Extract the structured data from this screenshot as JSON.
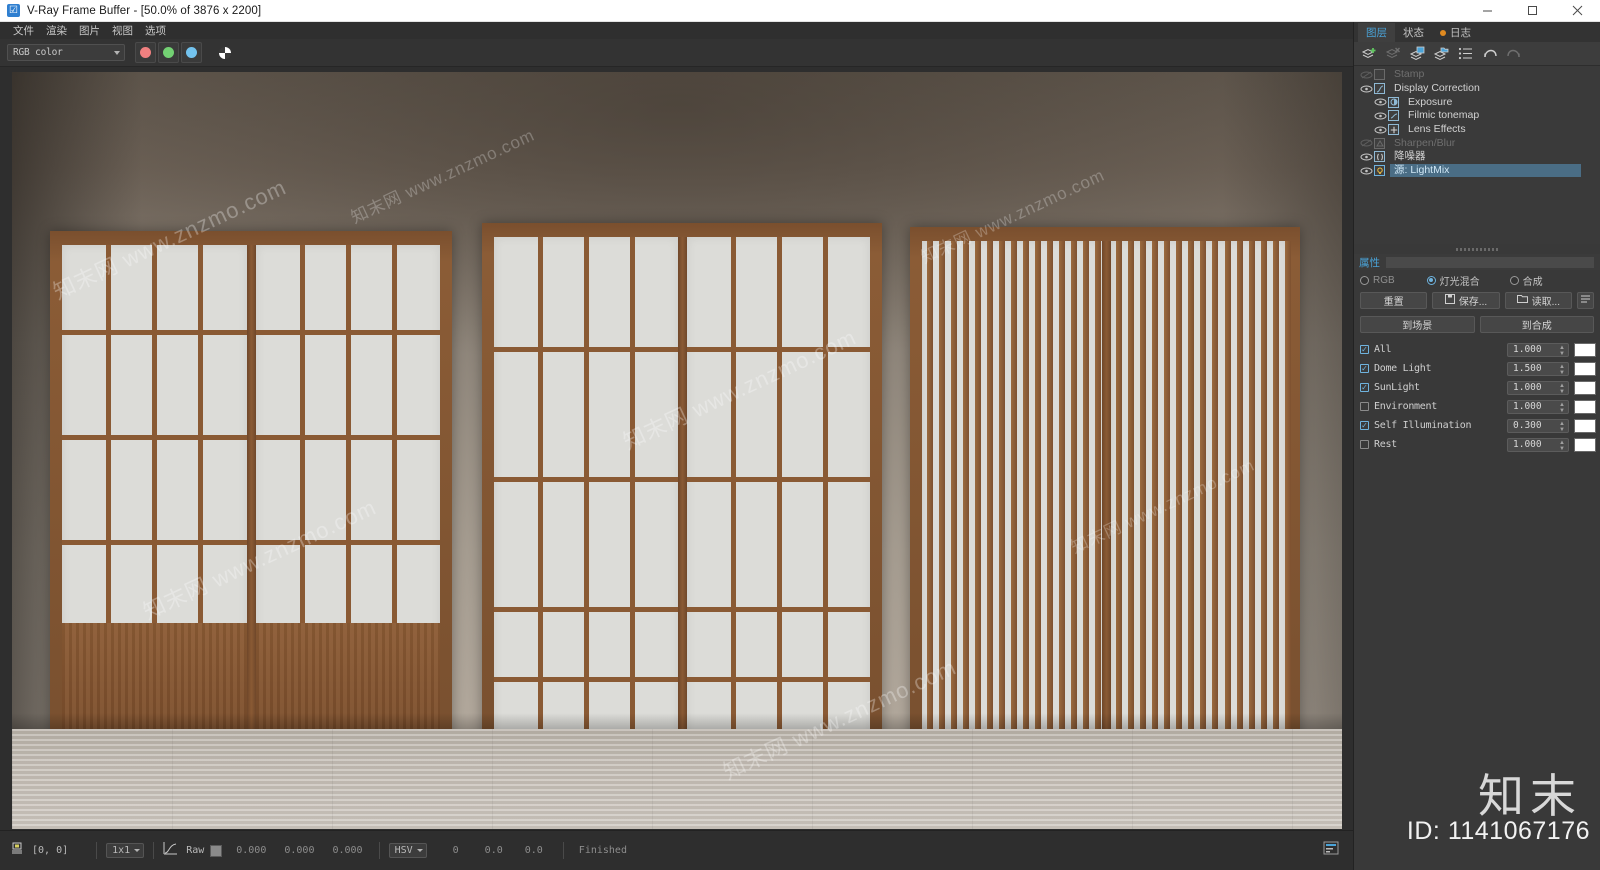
{
  "window": {
    "title": "V-Ray Frame Buffer - [50.0% of 3876 x 2200]",
    "app_icon": "vray-icon",
    "minimize": "−",
    "maximize": "□",
    "close": "✕"
  },
  "menu": {
    "items": [
      {
        "label": "文件",
        "name": "menu-file"
      },
      {
        "label": "渲染",
        "name": "menu-render"
      },
      {
        "label": "图片",
        "name": "menu-image"
      },
      {
        "label": "视图",
        "name": "menu-view"
      },
      {
        "label": "选项",
        "name": "menu-options"
      }
    ]
  },
  "toolbar": {
    "channel_select": {
      "value": "RGB color",
      "placeholder": "RGB color"
    },
    "channels": [
      {
        "name": "red-channel-button",
        "color": "#f08080"
      },
      {
        "name": "green-channel-button",
        "color": "#73d173"
      },
      {
        "name": "blue-channel-button",
        "color": "#73c3ee"
      }
    ],
    "alpha_button": "alpha-channel-button",
    "right_icons": [
      {
        "name": "save-image-icon"
      },
      {
        "name": "save-all-image-channels-icon"
      },
      {
        "name": "region-render-icon"
      },
      {
        "name": "show-vfb-window-icon"
      },
      {
        "name": "start-render-icon"
      },
      {
        "name": "stop-render-icon"
      },
      {
        "name": "render-last-icon"
      }
    ]
  },
  "render_view": {
    "description": "Japanese-style interior render: three wooden sliding shoji door units on a taupe wall, light gray wood plank floor",
    "watermarks": [
      "知末网 www.znzmo.com",
      "知末网 www.znzmo.com",
      "知末网 www.znzmo.com",
      "知末网 www.znzmo.com",
      "知末网 www.znzmo.com",
      "知末网 www.znzmo.com",
      "知末网 www.znzmo.com"
    ],
    "brand_watermark": {
      "logo": "知末",
      "id": "ID: 1141067176"
    }
  },
  "statusbar": {
    "pixel_icon": "pixel-probe-icon",
    "coords": "[0,  0]",
    "sample_size": "1x1",
    "curve_icon": "color-curve-icon",
    "raw_label": "Raw",
    "raw_swatch": "#8a8a8a",
    "raw_values": [
      "0.000",
      "0.000",
      "0.000"
    ],
    "color_space": "HSV",
    "hsv_values": [
      "0",
      "0.0",
      "0.0"
    ],
    "status": "Finished",
    "right_icon": "show-log-icon"
  },
  "right_panel": {
    "tabs": [
      {
        "label": "图层",
        "name": "tab-layers",
        "active": true,
        "dot": false
      },
      {
        "label": "状态",
        "name": "tab-status",
        "active": false,
        "dot": false
      },
      {
        "label": "日志",
        "name": "tab-log",
        "active": false,
        "dot": true
      }
    ],
    "layer_toolbar": [
      {
        "name": "add-layer-icon"
      },
      {
        "name": "delete-layer-icon"
      },
      {
        "name": "save-layer-preset-icon"
      },
      {
        "name": "load-layer-preset-icon"
      },
      {
        "name": "layer-list-options-icon"
      },
      {
        "name": "undo-icon"
      },
      {
        "name": "redo-icon"
      }
    ],
    "layers": [
      {
        "label": "Stamp",
        "name": "layer-stamp",
        "enabled": false,
        "selected": false,
        "indent": false,
        "glyph": "S"
      },
      {
        "label": "Display Correction",
        "name": "layer-display-correction",
        "enabled": true,
        "selected": false,
        "indent": false,
        "glyph": "◣"
      },
      {
        "label": "Exposure",
        "name": "layer-exposure",
        "enabled": true,
        "selected": false,
        "indent": true,
        "glyph": "◐"
      },
      {
        "label": "Filmic tonemap",
        "name": "layer-filmic-tonemap",
        "enabled": true,
        "selected": false,
        "indent": true,
        "glyph": "∿"
      },
      {
        "label": "Lens Effects",
        "name": "layer-lens-effects",
        "enabled": true,
        "selected": false,
        "indent": true,
        "glyph": "+"
      },
      {
        "label": "Sharpen/Blur",
        "name": "layer-sharpen-blur",
        "enabled": false,
        "selected": false,
        "indent": false,
        "glyph": "▲"
      },
      {
        "label": "降噪器",
        "name": "layer-denoiser",
        "enabled": true,
        "selected": false,
        "indent": false,
        "glyph": "()"
      },
      {
        "label": "源: LightMix",
        "name": "layer-source-lightmix",
        "enabled": true,
        "selected": true,
        "indent": false,
        "glyph": "◉"
      }
    ],
    "properties": {
      "title": "属性",
      "modes": [
        {
          "label": "RGB",
          "name": "mode-rgb",
          "selected": false
        },
        {
          "label": "灯光混合",
          "name": "mode-lightmix",
          "selected": true
        },
        {
          "label": "合成",
          "name": "mode-composite",
          "selected": false
        }
      ],
      "buttons": [
        {
          "label": "重置",
          "name": "reset-button",
          "icon": ""
        },
        {
          "label": "保存...",
          "name": "save-button",
          "icon": "save-icon"
        },
        {
          "label": "读取...",
          "name": "load-button",
          "icon": "folder-icon"
        },
        {
          "label": "",
          "name": "more-options-button",
          "icon": "list-icon"
        }
      ],
      "actions": [
        {
          "label": "到场景",
          "name": "to-scene-button"
        },
        {
          "label": "到合成",
          "name": "to-composite-button"
        }
      ],
      "lightmix": [
        {
          "label": "All",
          "name": "lightmix-all",
          "checked": true,
          "value": "1.000",
          "color": "#ffffff"
        },
        {
          "label": "Dome Light",
          "name": "lightmix-dome-light",
          "checked": true,
          "value": "1.500",
          "color": "#ffffff"
        },
        {
          "label": "SunLight",
          "name": "lightmix-sunlight",
          "checked": true,
          "value": "1.000",
          "color": "#ffffff"
        },
        {
          "label": "Environment",
          "name": "lightmix-environment",
          "checked": false,
          "value": "1.000",
          "color": "#ffffff"
        },
        {
          "label": "Self Illumination",
          "name": "lightmix-self-illumination",
          "checked": true,
          "value": "0.300",
          "color": "#ffffff"
        },
        {
          "label": "Rest",
          "name": "lightmix-rest",
          "checked": false,
          "value": "1.000",
          "color": "#ffffff"
        }
      ]
    }
  }
}
